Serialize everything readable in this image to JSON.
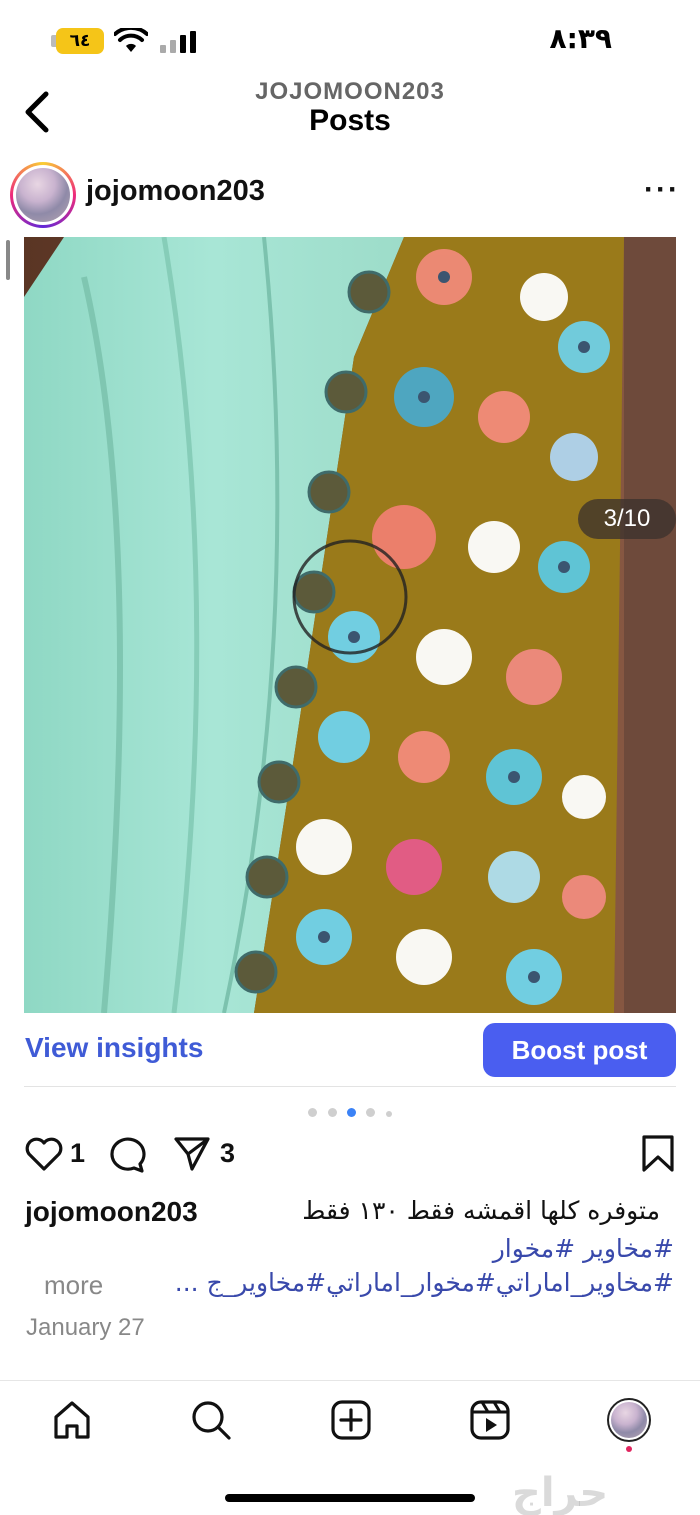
{
  "status_bar": {
    "battery": "٦٤",
    "time": "٨:٣٩"
  },
  "header": {
    "account": "JOJOMOON203",
    "title": "Posts"
  },
  "post": {
    "author": "jojomoon203",
    "image_counter": "3/10",
    "carousel": {
      "total_dots": 5,
      "active_index": 2
    },
    "view_insights_label": "View insights",
    "boost_label": "Boost post",
    "likes": "1",
    "shares": "3",
    "caption_user": "jojomoon203",
    "caption_text": "متوفره كلها اقمشه فقط ١٣٠ فقط",
    "hashtags_line1": "#مخاوير #مخوار",
    "hashtags_line2": "#مخاوير_اماراتي#مخوار_اماراتي#مخاوير_ج ...",
    "more_label": "more",
    "date": "January 27"
  },
  "icons": {
    "back": "chevron-left-icon",
    "more": "more-horizontal-icon",
    "like": "heart-icon",
    "comment": "comment-icon",
    "share": "send-icon",
    "save": "bookmark-icon",
    "nav": [
      "home-icon",
      "search-icon",
      "create-icon",
      "reels-icon",
      "profile-avatar"
    ]
  },
  "colors": {
    "accent": "#4a5ef0",
    "link": "#3f5bd6",
    "hashtag": "#3949ab",
    "active_dot": "#3b82f6"
  },
  "watermark": "حراج"
}
